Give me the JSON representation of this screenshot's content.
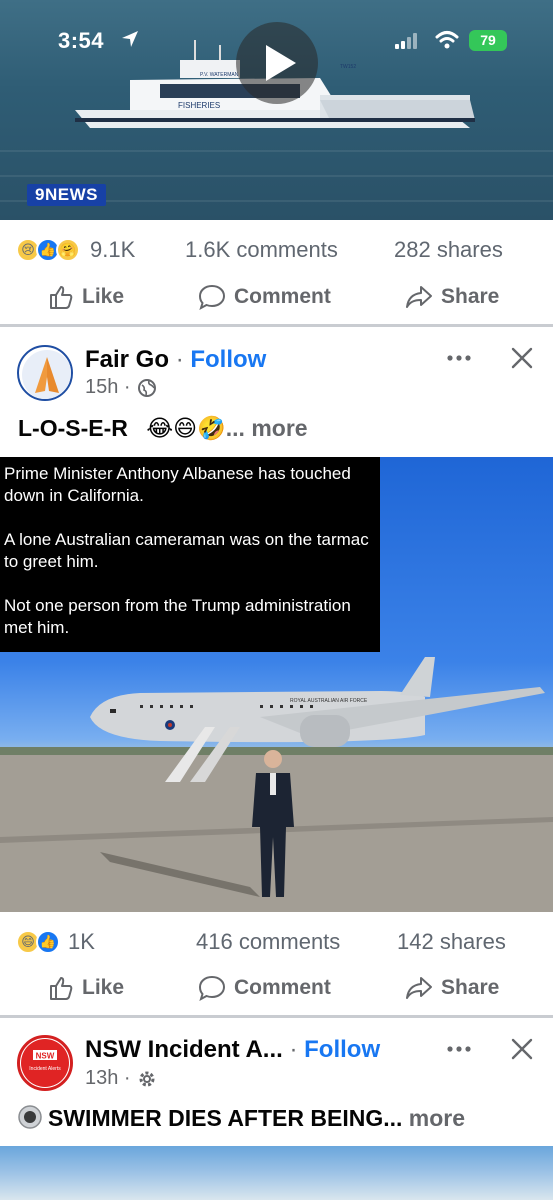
{
  "status_bar": {
    "time": "3:54",
    "battery": "79"
  },
  "video_post": {
    "boat_label": "FISHERIES",
    "boat_label_small": "P.V. WATERMAN",
    "boat_label_small2": "TW152",
    "news_logo": "9NEWS",
    "reaction_count": "9.1K",
    "comments": "1.6K comments",
    "shares": "282 shares",
    "actions": {
      "like": "Like",
      "comment": "Comment",
      "share": "Share"
    }
  },
  "post_fairgo": {
    "page_name": "Fair Go",
    "separator": "·",
    "follow": "Follow",
    "time": "15h ·",
    "caption": "L-O-S-E-R",
    "caption_emojis": "😂😄🤣",
    "more": "... more",
    "overlay": {
      "line1": "Prime Minister Anthony Albanese has touched down in California.",
      "line2": "A lone Australian cameraman was on the tarmac to greet him.",
      "line3": "Not one person from the Trump administration met him."
    },
    "plane_label": "ROYAL AUSTRALIAN AIR FORCE",
    "reaction_count": "1K",
    "comments": "416 comments",
    "shares": "142 shares",
    "actions": {
      "like": "Like",
      "comment": "Comment",
      "share": "Share"
    }
  },
  "post_nsw": {
    "page_name": "NSW Incident A...",
    "separator": "·",
    "follow": "Follow",
    "time": "13h ·",
    "avatar_text": "NSW",
    "avatar_sub": "Incident Alerts",
    "caption": "SWIMMER DIES AFTER BEING...",
    "more": "more"
  },
  "colors": {
    "accent": "#1877f2",
    "meta": "#65676b",
    "battery": "#34c759"
  }
}
